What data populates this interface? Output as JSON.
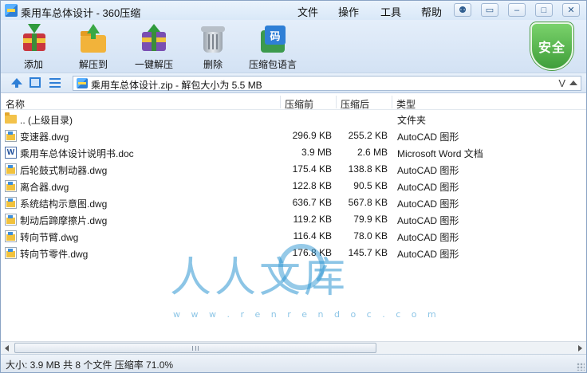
{
  "window": {
    "title": "乘用车总体设计 - 360压缩"
  },
  "menu": {
    "items": [
      "文件",
      "操作",
      "工具",
      "帮助"
    ]
  },
  "title_tools": {
    "icons": [
      "skin-icon",
      "menu-icon",
      "minimize-icon",
      "maximize-icon",
      "close-icon"
    ]
  },
  "toolbar": {
    "buttons": [
      {
        "label": "添加",
        "icon": "add-archive-icon"
      },
      {
        "label": "解压到",
        "icon": "extract-to-icon"
      },
      {
        "label": "一键解压",
        "icon": "one-click-extract-icon"
      },
      {
        "label": "删除",
        "icon": "delete-bin-icon"
      },
      {
        "label": "压缩包语言",
        "icon": "archive-language-icon",
        "glyph": "码"
      }
    ],
    "security_badge": "安全"
  },
  "address": {
    "path": "乘用车总体设计.zip - 解包大小为 5.5 MB",
    "dropdown_glyph": "V"
  },
  "list": {
    "columns": [
      "名称",
      "压缩前",
      "压缩后",
      "类型"
    ],
    "rows": [
      {
        "name": ".. (上级目录)",
        "before": "",
        "after": "",
        "type": "文件夹",
        "icon": "folder-icon"
      },
      {
        "name": "变速器.dwg",
        "before": "296.9 KB",
        "after": "255.2 KB",
        "type": "AutoCAD 图形",
        "icon": "dwg-file-icon"
      },
      {
        "name": "乘用车总体设计说明书.doc",
        "before": "3.9 MB",
        "after": "2.6 MB",
        "type": "Microsoft Word 文档",
        "icon": "word-file-icon"
      },
      {
        "name": "后轮鼓式制动器.dwg",
        "before": "175.4 KB",
        "after": "138.8 KB",
        "type": "AutoCAD 图形",
        "icon": "dwg-file-icon"
      },
      {
        "name": "离合器.dwg",
        "before": "122.8 KB",
        "after": "90.5 KB",
        "type": "AutoCAD 图形",
        "icon": "dwg-file-icon"
      },
      {
        "name": "系统结构示意图.dwg",
        "before": "636.7 KB",
        "after": "567.8 KB",
        "type": "AutoCAD 图形",
        "icon": "dwg-file-icon"
      },
      {
        "name": "制动后蹄摩擦片.dwg",
        "before": "119.2 KB",
        "after": "79.9 KB",
        "type": "AutoCAD 图形",
        "icon": "dwg-file-icon"
      },
      {
        "name": "转向节臂.dwg",
        "before": "116.4 KB",
        "after": "78.0 KB",
        "type": "AutoCAD 图形",
        "icon": "dwg-file-icon"
      },
      {
        "name": "转向节零件.dwg",
        "before": "176.8 KB",
        "after": "145.7 KB",
        "type": "AutoCAD 图形",
        "icon": "dwg-file-icon"
      }
    ]
  },
  "watermark": {
    "text": "人人文库",
    "url": "w w w . r e n r e n d o c . c o m"
  },
  "status": {
    "text": "大小: 3.9 MB 共 8 个文件 压缩率 71.0%"
  }
}
